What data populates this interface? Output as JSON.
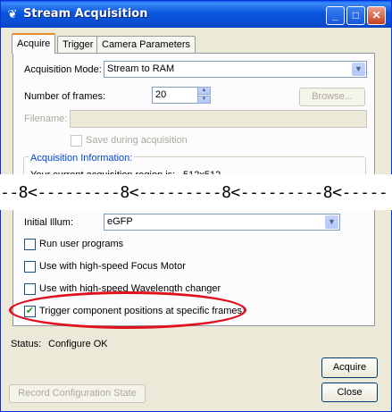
{
  "window": {
    "title": "Stream Acquisition",
    "title_icon": "butterfly-icon"
  },
  "title_buttons": {
    "minimize": "_",
    "maximize": "□",
    "close": "✕"
  },
  "tabs": [
    {
      "label": "Acquire"
    },
    {
      "label": "Trigger"
    },
    {
      "label": "Camera Parameters"
    }
  ],
  "acquire": {
    "acq_mode_label": "Acquisition Mode:",
    "acq_mode_value": "Stream to RAM",
    "frames_label": "Number of frames:",
    "frames_value": "20",
    "browse_label": "Browse...",
    "filename_label": "Filename:",
    "filename_value": "",
    "save_during_label": "Save during acquisition",
    "acq_info_title": "Acquisition Information:",
    "acq_info_text": "Your current acquisition region is:",
    "acq_info_value": "512x512",
    "tear_text": "--8<---------8<---------8<---------8<-----",
    "illum_label": "Initial Illum:",
    "illum_value": "eGFP",
    "run_user_label": "Run user programs",
    "focus_motor_label": "Use with high-speed Focus Motor",
    "wavelength_label": "Use with high-speed Wavelength changer",
    "trigger_pos_label": "Trigger component positions at specific frames",
    "trigger_pos_check": "✔"
  },
  "status": {
    "label": "Status:",
    "value": "Configure OK"
  },
  "buttons": {
    "acquire": "Acquire",
    "close": "Close",
    "record": "Record Configuration State"
  },
  "colors": {
    "highlight_ellipse": "#e0101c",
    "titlebar": "#0a5cf5"
  }
}
